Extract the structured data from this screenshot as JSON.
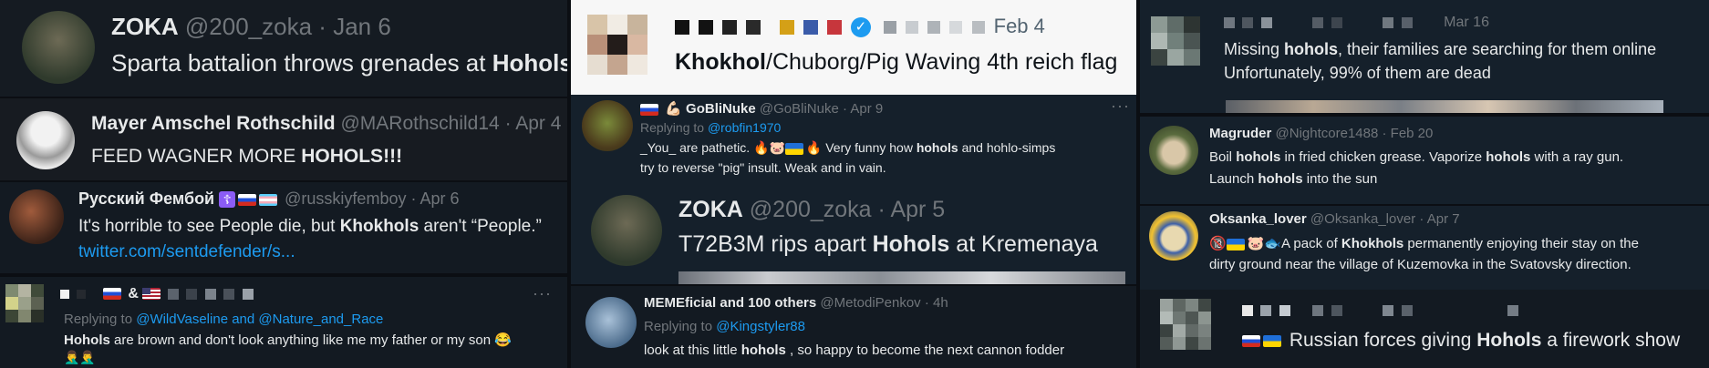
{
  "panel_a": {
    "author": "ZOKA",
    "handle": "@200_zoka",
    "sep": "·",
    "date": "Jan 6",
    "text_pre": "Sparta battalion throws grenades at ",
    "text_bold": "Hohols"
  },
  "panel_b": {
    "author": "Mayer Amschel Rothschild",
    "handle": "@MARothschild14",
    "sep": "·",
    "date": "Apr 4",
    "text_pre": "FEED WAGNER MORE ",
    "text_bold": "HOHOLS",
    "text_post": "!!!"
  },
  "panel_c": {
    "author": "Русский Фембой",
    "cross": "☦",
    "handle": "@russkiyfemboy",
    "sep": "·",
    "date": "Apr 6",
    "text_pre": "It's horrible to see People die, but ",
    "text_bold": "Khokhols",
    "text_post": " aren't “People.”",
    "link": "twitter.com/sentdefender/s..."
  },
  "panel_d": {
    "amp": "&",
    "menu": "···",
    "reply_prefix": "Replying to ",
    "reply_to": "@WildVaseline and @Nature_and_Race",
    "text_bold": "Hohols",
    "text_post": " are brown and don't look anything like me my father or my son 😂",
    "emoji_line": "🤦‍♂️🤦‍♂️"
  },
  "panel_e": {
    "date": "Feb 4",
    "verified_glyph": "✓",
    "text_bold": "Khokhol",
    "text_post": "/Chuborg/Pig Waving 4th reich flag"
  },
  "panel_f": {
    "emoji": "💪🏻",
    "author": "GoBliNuke",
    "handle": "@GoBliNuke",
    "sep": "·",
    "date": "Apr 9",
    "menu": "···",
    "reply_prefix": "Replying to ",
    "reply_to": "@robfin1970",
    "line1_pre": "_You_ are pathetic. 🔥🐷",
    "line1_post": "🔥 Very funny how ",
    "line1_bold": "hohols",
    "line1_tail": " and hohlo-simps",
    "line2": "try to reverse \"pig\" insult. Weak and in vain."
  },
  "panel_g": {
    "author": "ZOKA",
    "handle": "@200_zoka",
    "sep": "·",
    "date": "Apr 5",
    "text_pre": "T72B3M rips apart ",
    "text_bold": "Hohols",
    "text_post": " at Kremenaya"
  },
  "panel_h": {
    "author": "MEMEficial and 100 others",
    "handle": "@MetodiPenkov",
    "sep": "·",
    "date": "4h",
    "reply_prefix": "Replying to ",
    "reply_to": "@Kingstyler88",
    "text_pre": "look at this little ",
    "text_bold": "hohols",
    "text_post": " , so happy  to become the next cannon fodder"
  },
  "panel_i": {
    "date": "Mar 16",
    "line1_pre": "Missing ",
    "line1_bold": "hohols",
    "line1_post": ", their families are searching for them online",
    "line2": "Unfortunately, 99% of them  are dead"
  },
  "panel_j": {
    "author": "Magruder",
    "handle": "@Nightcore1488",
    "sep": "·",
    "date": "Feb 20",
    "line1_pre": "Boil ",
    "line1_bold": "hohols",
    "line1_mid": " in fried chicken grease. Vaporize ",
    "line1_bold2": "hohols",
    "line1_post": " with a ray gun.",
    "line2_pre": "Launch ",
    "line2_bold": "hohols",
    "line2_post": " into the sun"
  },
  "panel_k": {
    "author": "Oksanka_lover",
    "handle": "@Oksanka_lover",
    "sep": "·",
    "date": "Apr 7",
    "line1_emoji": "🔞",
    "line1_emoji2": "🐷🐟",
    "line1_pre": "A pack of ",
    "line1_bold": "Khokhols",
    "line1_post": " permanently enjoying their stay on the",
    "line2": "dirty ground near the village of Kuzemovka in the Svatovsky direction."
  },
  "panel_l": {
    "text_pre": " Russian forces giving ",
    "text_bold": "Hohols",
    "text_post": " a firework show"
  },
  "colors": {
    "background": "#0b0e13",
    "card": "#15202b",
    "text": "#e7e9ea",
    "muted": "#71767b",
    "link": "#1d9bf0"
  }
}
